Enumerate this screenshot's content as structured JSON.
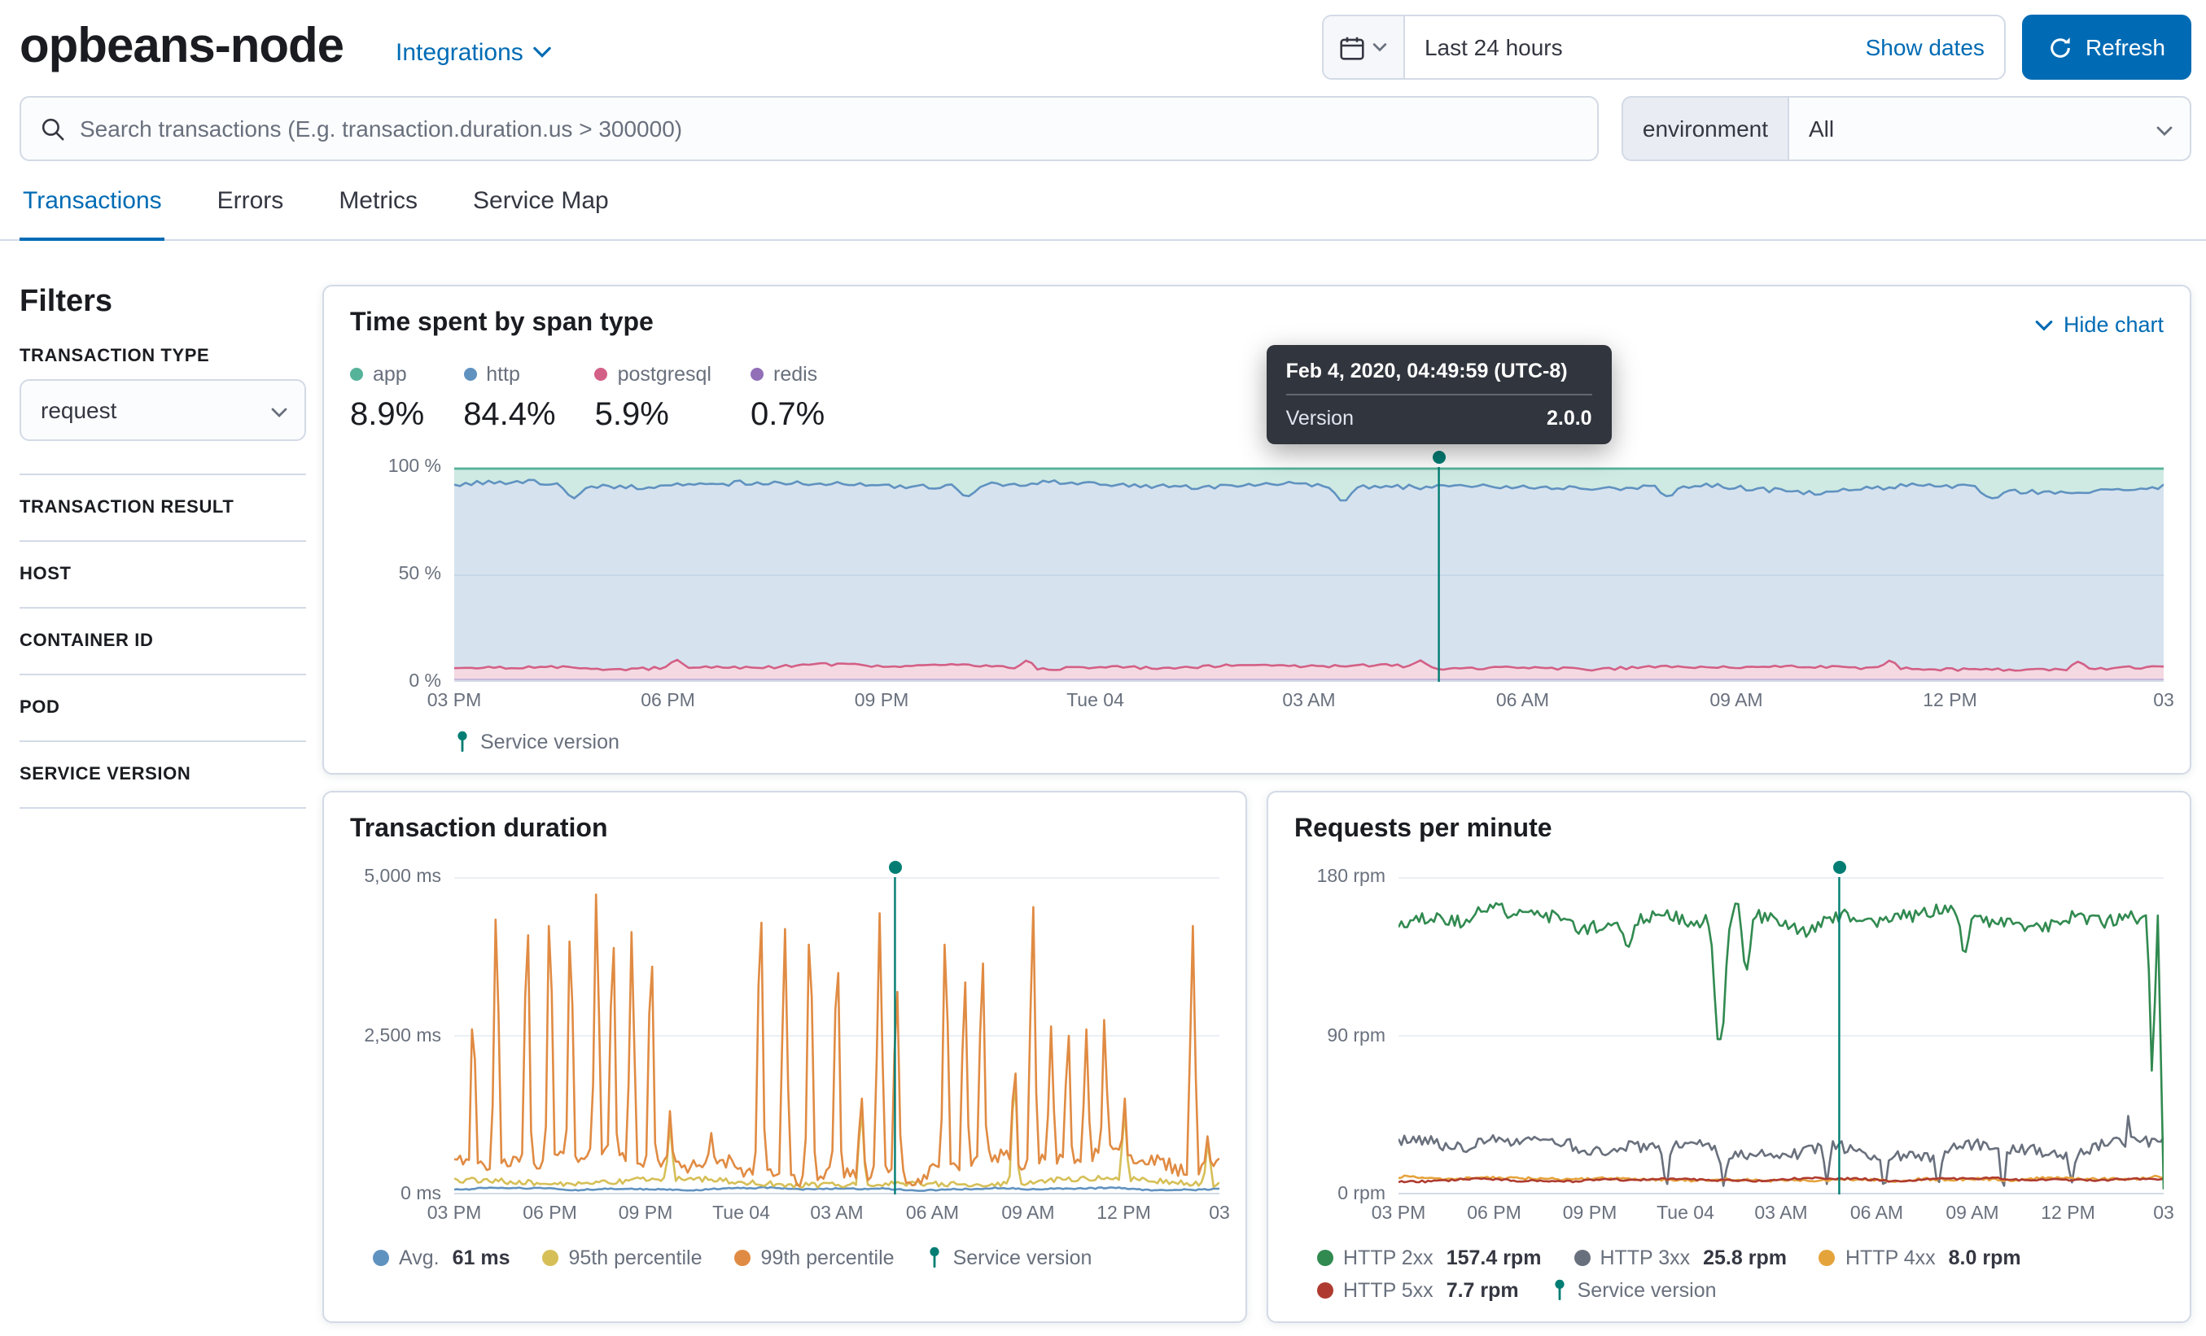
{
  "header": {
    "service_name": "opbeans-node",
    "integrations_label": "Integrations",
    "time_range": "Last 24 hours",
    "show_dates_label": "Show dates",
    "refresh_label": "Refresh"
  },
  "search": {
    "placeholder": "Search transactions (E.g. transaction.duration.us > 300000)",
    "environment_label": "environment",
    "environment_value": "All"
  },
  "tabs": [
    {
      "label": "Transactions",
      "active": true
    },
    {
      "label": "Errors",
      "active": false
    },
    {
      "label": "Metrics",
      "active": false
    },
    {
      "label": "Service Map",
      "active": false
    }
  ],
  "filters": {
    "title": "Filters",
    "transaction_type_label": "TRANSACTION TYPE",
    "transaction_type_value": "request",
    "sections": [
      "TRANSACTION RESULT",
      "HOST",
      "CONTAINER ID",
      "POD",
      "SERVICE VERSION"
    ]
  },
  "span_card": {
    "title": "Time spent by span type",
    "hide_chart_label": "Hide chart",
    "tooltip": {
      "title": "Feb 4, 2020, 04:49:59 (UTC-8)",
      "label": "Version",
      "value": "2.0.0"
    }
  },
  "duration_card": {
    "title": "Transaction duration"
  },
  "rpm_card": {
    "title": "Requests per minute"
  },
  "labels": {
    "service_version": "Service version"
  },
  "colors": {
    "annotation": "#017D73",
    "primary": "#006BB4"
  },
  "chart_data": [
    {
      "id": "span-type",
      "type": "area",
      "title": "Time spent by span type",
      "x_ticks": [
        "03 PM",
        "06 PM",
        "09 PM",
        "Tue 04",
        "03 AM",
        "06 AM",
        "09 AM",
        "12 PM",
        "03"
      ],
      "y_ticks": [
        "100 %",
        "50 %",
        "0 %"
      ],
      "ylim": [
        0,
        100
      ],
      "annotation_x": 0.576,
      "bands": [
        {
          "name": "app",
          "pct": "8.9%",
          "color": "#54B399"
        },
        {
          "name": "http",
          "pct": "84.4%",
          "color": "#6092C0"
        },
        {
          "name": "postgresql",
          "pct": "5.9%",
          "color": "#D36086"
        },
        {
          "name": "redis",
          "pct": "0.7%",
          "color": "#9170B8"
        }
      ],
      "layers": {
        "redis_top": 0.8,
        "pg": {
          "base": 6.0,
          "noise": 1.4,
          "bumps": [
            [
              0.13,
              9.6
            ],
            [
              0.335,
              9.2
            ],
            [
              0.565,
              9.4
            ],
            [
              0.84,
              9.2
            ],
            [
              0.95,
              8.8
            ]
          ]
        },
        "http": {
          "base": 91.5,
          "noise": 2.6,
          "dips": [
            [
              0.07,
              86,
              0.005
            ],
            [
              0.3,
              87,
              0.005
            ],
            [
              0.52,
              85,
              0.006
            ],
            [
              0.71,
              87,
              0.005
            ],
            [
              0.9,
              86,
              0.006
            ]
          ]
        },
        "app_top": 100
      }
    },
    {
      "id": "duration",
      "type": "line",
      "title": "Transaction duration",
      "x_ticks": [
        "03 PM",
        "06 PM",
        "09 PM",
        "Tue 04",
        "03 AM",
        "06 AM",
        "09 AM",
        "12 PM",
        "03"
      ],
      "y_ticks": [
        "5,000 ms",
        "2,500 ms",
        "0 ms"
      ],
      "ylim": [
        0,
        5000
      ],
      "annotation_x": 0.576,
      "series": [
        {
          "name": "avg",
          "label": "Avg.",
          "value": "61 ms",
          "color": "#6092C0",
          "base": 61,
          "noise": 22
        },
        {
          "name": "p95",
          "label": "95th percentile",
          "color": "#D6BF57",
          "base": 165,
          "noise": 95,
          "spikes": [
            [
              0.282,
              1100
            ],
            [
              0.532,
              1300
            ],
            [
              0.732,
              1700
            ],
            [
              0.876,
              1300
            ],
            [
              0.985,
              800
            ]
          ]
        },
        {
          "name": "p99",
          "label": "99th percentile",
          "color": "#E08B43",
          "base": 420,
          "noise": 240,
          "spikes": [
            [
              0.025,
              2600
            ],
            [
              0.055,
              4350
            ],
            [
              0.095,
              4100
            ],
            [
              0.125,
              4250
            ],
            [
              0.152,
              4000
            ],
            [
              0.186,
              4750
            ],
            [
              0.207,
              3900
            ],
            [
              0.232,
              4150
            ],
            [
              0.257,
              3600
            ],
            [
              0.282,
              1300
            ],
            [
              0.335,
              950
            ],
            [
              0.4,
              4300
            ],
            [
              0.432,
              4200
            ],
            [
              0.465,
              3950
            ],
            [
              0.5,
              3500
            ],
            [
              0.532,
              1500
            ],
            [
              0.556,
              4450
            ],
            [
              0.578,
              3200
            ],
            [
              0.642,
              3950
            ],
            [
              0.667,
              3350
            ],
            [
              0.69,
              3650
            ],
            [
              0.732,
              1900
            ],
            [
              0.756,
              4550
            ],
            [
              0.78,
              2650
            ],
            [
              0.802,
              2500
            ],
            [
              0.826,
              2600
            ],
            [
              0.85,
              2750
            ],
            [
              0.876,
              1500
            ],
            [
              0.965,
              4250
            ],
            [
              0.985,
              900
            ]
          ]
        }
      ]
    },
    {
      "id": "rpm",
      "type": "line",
      "title": "Requests per minute",
      "x_ticks": [
        "03 PM",
        "06 PM",
        "09 PM",
        "Tue 04",
        "03 AM",
        "06 AM",
        "09 AM",
        "12 PM",
        "03"
      ],
      "y_ticks": [
        "180 rpm",
        "90 rpm",
        "0 rpm"
      ],
      "ylim": [
        0,
        180
      ],
      "annotation_x": 0.576,
      "series": [
        {
          "name": "http3xx",
          "label": "HTTP 3xx",
          "value": "25.8 rpm",
          "color": "#69707D",
          "base": 26,
          "noise": 7,
          "dips": [
            [
              0.35,
              5,
              0.004
            ],
            [
              0.425,
              4,
              0.004
            ],
            [
              0.56,
              5,
              0.004
            ],
            [
              0.635,
              4,
              0.004
            ],
            [
              0.705,
              6,
              0.004
            ],
            [
              0.79,
              4,
              0.004
            ],
            [
              0.88,
              6,
              0.004
            ]
          ],
          "spikes": [
            [
              0.955,
              44
            ]
          ]
        },
        {
          "name": "http4xx",
          "label": "HTTP 4xx",
          "value": "8.0 rpm",
          "color": "#E5A33C",
          "base": 8,
          "noise": 1.6
        },
        {
          "name": "http5xx",
          "label": "HTTP 5xx",
          "value": "7.7 rpm",
          "color": "#AF3B30",
          "base": 7.4,
          "noise": 1.2
        },
        {
          "name": "http2xx",
          "label": "HTTP 2xx",
          "value": "157.4 rpm",
          "color": "#318A50",
          "base": 157,
          "noise": 8,
          "dips": [
            [
              0.3,
              141,
              0.006
            ],
            [
              0.42,
              88,
              0.009
            ],
            [
              0.455,
              128,
              0.006
            ],
            [
              0.74,
              138,
              0.006
            ],
            [
              0.985,
              70,
              0.004
            ]
          ],
          "end_drop": true
        }
      ]
    }
  ]
}
